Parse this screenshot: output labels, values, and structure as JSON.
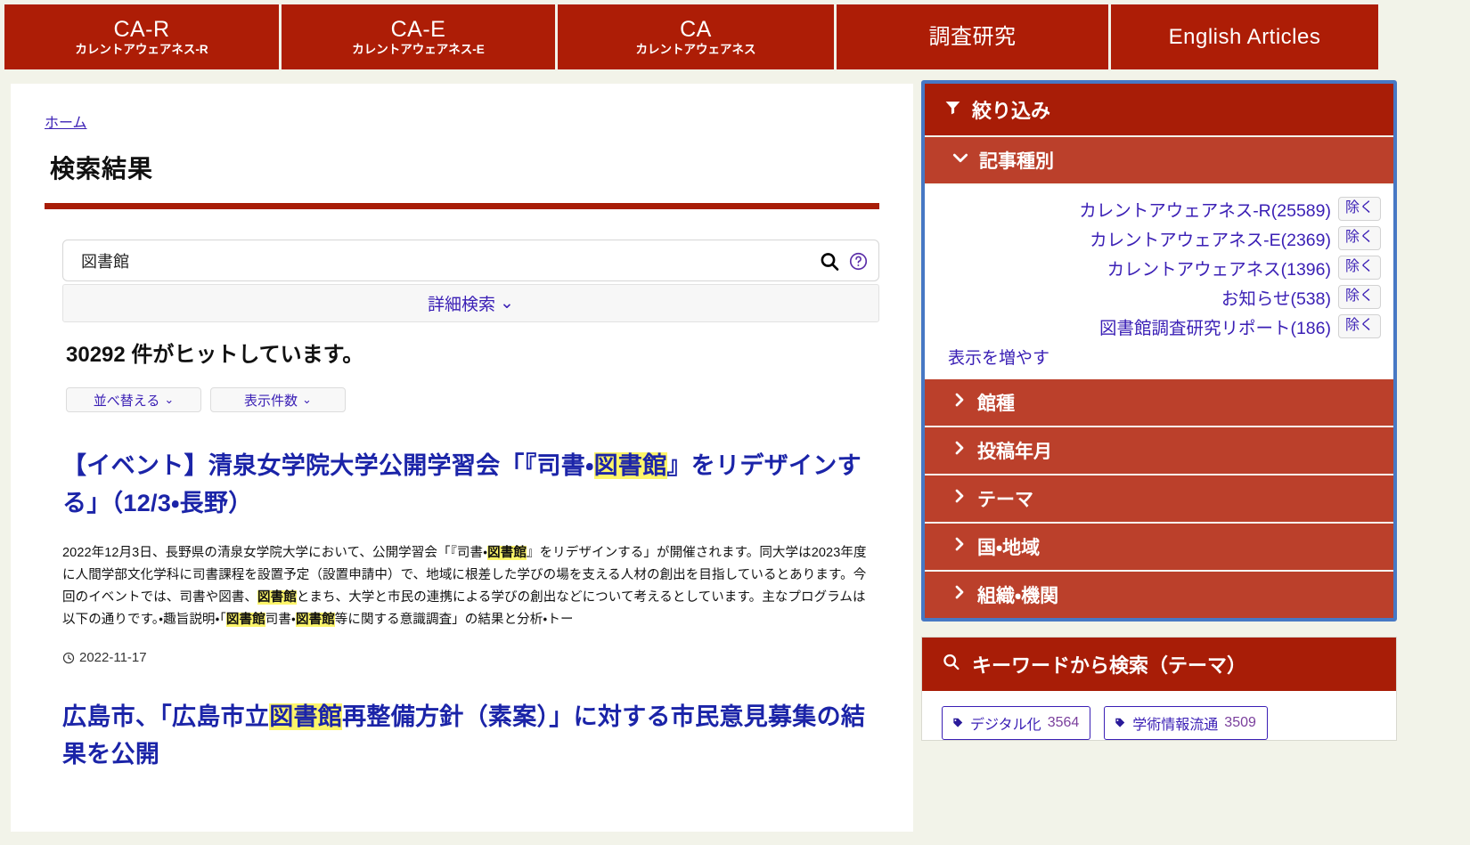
{
  "global_nav": [
    {
      "main": "CA-R",
      "sub": "カレントアウェアネス-R",
      "width_class": "w1"
    },
    {
      "main": "CA-E",
      "sub": "カレントアウェアネス-E",
      "width_class": "w2"
    },
    {
      "main": "CA",
      "sub": "カレントアウェアネス",
      "width_class": "w3"
    },
    {
      "main": "調査研究",
      "sub": "",
      "width_class": "w4"
    },
    {
      "main": "English Articles",
      "sub": "",
      "width_class": "w5"
    }
  ],
  "breadcrumb": {
    "home": "ホーム"
  },
  "page": {
    "title": "検索結果"
  },
  "search": {
    "value": "図書館",
    "placeholder": "",
    "search_icon": "search-icon",
    "help_icon": "help-circle-icon",
    "advanced_label": "詳細検索",
    "advanced_caret": "⌄"
  },
  "hits": {
    "text": "30292 件がヒットしています。"
  },
  "controls": [
    {
      "label": "並べ替える",
      "caret": "⌄"
    },
    {
      "label": "表示件数",
      "caret": "⌄"
    }
  ],
  "results": [
    {
      "title_parts": [
        {
          "t": "【イベント】清泉女学院大学公開学習会「『司書・",
          "hl": false
        },
        {
          "t": "図書館",
          "hl": true
        },
        {
          "t": "』をリデザインする」（12/3・長野）",
          "hl": false
        }
      ],
      "snippet_parts": [
        {
          "t": "2022年12月3日、長野県の清泉女学院大学において、公開学習会「『司書・",
          "hl": false
        },
        {
          "t": "図書館",
          "hl": true
        },
        {
          "t": "』をリデザインする」が開催されます。同大学は2023年度に人間学部文化学科に司書課程を設置予定（設置申請中）で、地域に根差した学びの場を支える人材の創出を目指しているとあります。今回のイベントでは、司書や図書、",
          "hl": false
        },
        {
          "t": "図書館",
          "hl": true
        },
        {
          "t": "とまち、大学と市民の連携による学びの創出などについて考えるとしています。主なプログラムは以下の通りです。・趣旨説明・「",
          "hl": false
        },
        {
          "t": "図書館",
          "hl": true
        },
        {
          "t": "司書・",
          "hl": false
        },
        {
          "t": "図書館",
          "hl": true
        },
        {
          "t": "等に関する意識調査」の結果と分析・トー",
          "hl": false
        }
      ],
      "date": "2022-11-17",
      "date_icon": "clock-icon"
    },
    {
      "title_parts": [
        {
          "t": "広島市、「広島市立",
          "hl": false
        },
        {
          "t": "図書館",
          "hl": true
        },
        {
          "t": "再整備方針（素案）」に対する市民意見募集の結果を公開",
          "hl": false
        }
      ],
      "snippet_parts": [],
      "date": "",
      "date_icon": ""
    }
  ],
  "facets": {
    "header": {
      "label": "絞り込み",
      "icon": "filter-icon"
    },
    "open_section": {
      "label": "記事種別",
      "icon": "chevron-down-icon",
      "items": [
        {
          "label": "カレントアウェアネス-R(25589)",
          "button": "除く"
        },
        {
          "label": "カレントアウェアネス-E(2369)",
          "button": "除く"
        },
        {
          "label": "カレントアウェアネス(1396)",
          "button": "除く"
        },
        {
          "label": "お知らせ(538)",
          "button": "除く"
        },
        {
          "label": "図書館調査研究リポート(186)",
          "button": "除く"
        }
      ],
      "more_label": "表示を増やす"
    },
    "closed_sections": [
      {
        "label": "館種",
        "icon": "chevron-right-icon"
      },
      {
        "label": "投稿年月",
        "icon": "chevron-right-icon"
      },
      {
        "label": "テーマ",
        "icon": "chevron-right-icon"
      },
      {
        "label": "国・地域",
        "icon": "chevron-right-icon"
      },
      {
        "label": "組織・機関",
        "icon": "chevron-right-icon"
      }
    ]
  },
  "keyword_panel": {
    "header": {
      "label": "キーワードから検索（テーマ）",
      "icon": "search-icon"
    },
    "tags": [
      {
        "label": "デジタル化",
        "count": "3564",
        "icon": "tag-icon"
      },
      {
        "label": "学術情報流通",
        "count": "3509",
        "icon": "tag-icon"
      }
    ]
  },
  "colors": {
    "brand_red": "#a81d07",
    "nav_red": "#ad1d06",
    "sub_red": "#bb402b",
    "panel_blue": "#4778c4",
    "link_blue": "#3a1fb5",
    "title_blue": "#1b24a8",
    "highlight_yellow": "#fdf569",
    "page_bg": "#f2f3e9"
  }
}
